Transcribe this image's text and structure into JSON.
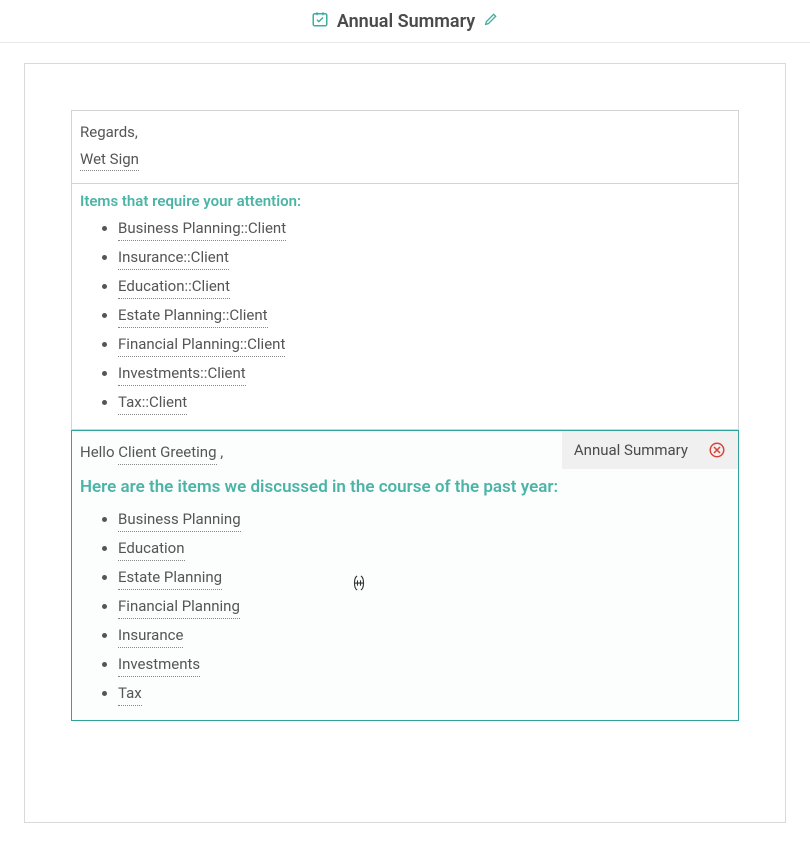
{
  "header": {
    "title": "Annual Summary"
  },
  "block1": {
    "regards": "Regards,",
    "signature": "Wet Sign"
  },
  "block2": {
    "heading": "Items that require your attention:",
    "items": [
      "Business Planning::Client",
      "Insurance::Client",
      "Education::Client",
      "Estate Planning::Client",
      "Financial Planning::Client",
      "Investments::Client",
      "Tax::Client"
    ]
  },
  "block3": {
    "hello": "Hello",
    "greeting_token": "Client Greeting",
    "comma": " ,",
    "heading": "Here are the items we discussed in the course of the past year:",
    "items": [
      "Business Planning",
      "Education",
      "Estate Planning",
      "Financial Planning",
      "Insurance",
      "Investments",
      "Tax"
    ],
    "tag": "Annual Summary"
  }
}
